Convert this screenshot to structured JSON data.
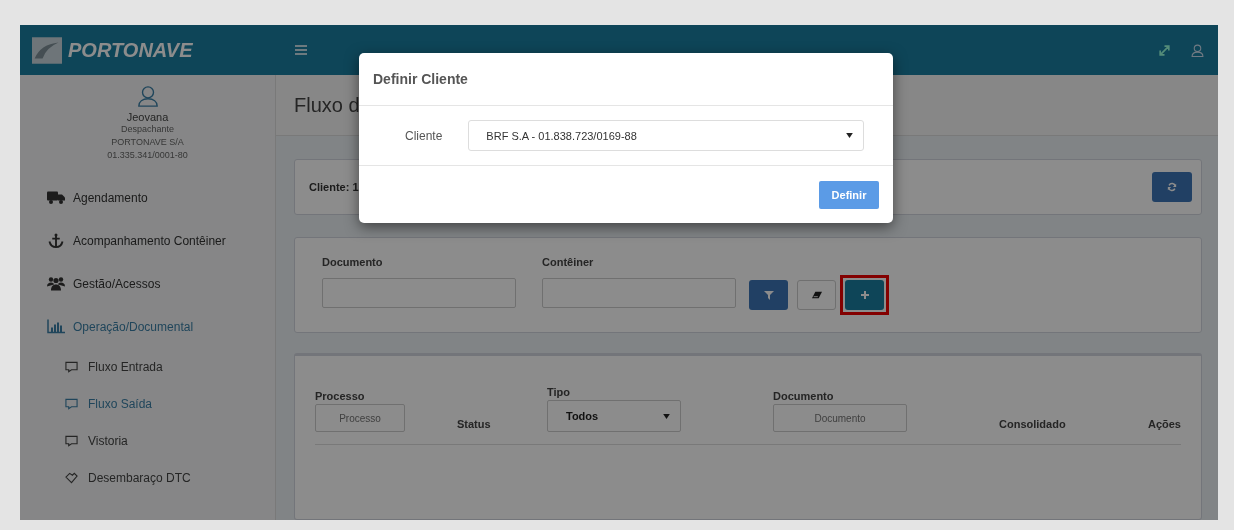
{
  "header": {
    "brand": "PORTONAVE"
  },
  "user": {
    "name": "Jeovana",
    "role": "Despachante",
    "company": "PORTONAVE S/A",
    "document": "01.335.341/0001-80"
  },
  "menu": [
    {
      "label": "Agendamento",
      "selected": false
    },
    {
      "label": "Acompanhamento Contêiner",
      "selected": false
    },
    {
      "label": "Gestão/Acessos",
      "selected": false
    },
    {
      "label": "Operação/Documental",
      "selected": true,
      "children": [
        {
          "label": "Fluxo Entrada",
          "selected": false
        },
        {
          "label": "Fluxo Saída",
          "selected": true
        },
        {
          "label": "Vistoria",
          "selected": false
        },
        {
          "label": "Desembaraço DTC",
          "selected": false
        }
      ]
    }
  ],
  "page": {
    "title": "Fluxo d"
  },
  "client_card": {
    "label": "Cliente: 1"
  },
  "filters": {
    "fields": [
      {
        "label": "Documento"
      },
      {
        "label": "Contêiner"
      }
    ],
    "highlighted": true
  },
  "table": {
    "columns": [
      {
        "kind": "input",
        "label": "Processo",
        "placeholder": "Processo"
      },
      {
        "kind": "text",
        "label": "Status"
      },
      {
        "kind": "select",
        "label": "Tipo",
        "value": "Todos"
      },
      {
        "kind": "input",
        "label": "Documento",
        "placeholder": "Documento"
      },
      {
        "kind": "text",
        "label": "Consolidado"
      },
      {
        "kind": "text",
        "label": "Ações"
      }
    ]
  },
  "modal": {
    "title": "Definir Cliente",
    "field_label": "Cliente",
    "value": "BRF S.A - 01.838.723/0169-88",
    "button": "Definir"
  }
}
